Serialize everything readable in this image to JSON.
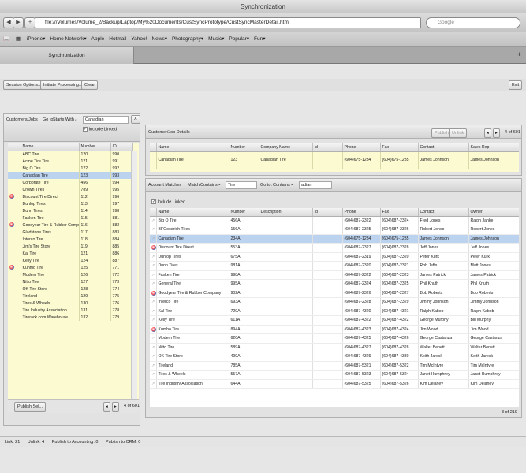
{
  "window": {
    "title": "Synchronization"
  },
  "browser": {
    "url": "file:///Volumes/Volume_2/Backup/Laptop/My%20Documents/CustSyncPrototype/CustSyncMasterDetail.htm",
    "search_placeholder": "Google",
    "bookmarks": [
      "iPhone▾",
      "Home Network▾",
      "Apple",
      "Hotmail",
      "Yahoo!",
      "News▾",
      "Photography▾",
      "Music▾",
      "Popular▾",
      "Fun▾"
    ],
    "tab_label": "Synchronization"
  },
  "toolbar": {
    "session_options": "Session Options...",
    "initiate_processing": "Initiate Processing...",
    "clear": "Clear",
    "exit": "Exit"
  },
  "left_panel": {
    "title": "Customers/Jobs",
    "goto_label": "Go to:",
    "goto_mode": "Starts With",
    "goto_value": "Canadian",
    "clear_x": "X",
    "include_linked": "Include Linked",
    "columns": [
      "Name",
      "Number",
      "ID"
    ],
    "rows": [
      {
        "name": "ABC Tire",
        "number": "120",
        "id": "990",
        "icon": false
      },
      {
        "name": "Acme Tire Tire",
        "number": "121",
        "id": "991",
        "icon": false
      },
      {
        "name": "Big O Tire",
        "number": "122",
        "id": "992",
        "icon": false
      },
      {
        "name": "Canadian Tire",
        "number": "123",
        "id": "993",
        "icon": false
      },
      {
        "name": "Corporate Tire",
        "number": "456",
        "id": "994",
        "icon": false
      },
      {
        "name": "Crown Tires",
        "number": "789",
        "id": "995",
        "icon": false
      },
      {
        "name": "Discount Tire Direct",
        "number": "112",
        "id": "996",
        "icon": true
      },
      {
        "name": "Dunlop Tires",
        "number": "113",
        "id": "997",
        "icon": false
      },
      {
        "name": "Dunn Tires",
        "number": "114",
        "id": "998",
        "icon": false
      },
      {
        "name": "Fasken Tire",
        "number": "115",
        "id": "881",
        "icon": false
      },
      {
        "name": "Goodyear Tire & Rubber Company",
        "number": "116",
        "id": "882",
        "icon": true
      },
      {
        "name": "Gladstone Tires",
        "number": "117",
        "id": "883",
        "icon": false
      },
      {
        "name": "Interco Tire",
        "number": "118",
        "id": "884",
        "icon": false
      },
      {
        "name": "Jim's Tire Store",
        "number": "119",
        "id": "885",
        "icon": false
      },
      {
        "name": "Kal Tire",
        "number": "121",
        "id": "886",
        "icon": false
      },
      {
        "name": "Kelly Tire",
        "number": "124",
        "id": "887",
        "icon": false
      },
      {
        "name": "Kuhmo Tire",
        "number": "125",
        "id": "771",
        "icon": true
      },
      {
        "name": "Modern Tire",
        "number": "126",
        "id": "772",
        "icon": false
      },
      {
        "name": "Nitto Tire",
        "number": "127",
        "id": "773",
        "icon": false
      },
      {
        "name": "OK Tire Store",
        "number": "128",
        "id": "774",
        "icon": false
      },
      {
        "name": "Tireland",
        "number": "129",
        "id": "775",
        "icon": false
      },
      {
        "name": "Tires & Wheels",
        "number": "130",
        "id": "776",
        "icon": false
      },
      {
        "name": "Tire Industry Association",
        "number": "131",
        "id": "778",
        "icon": false
      },
      {
        "name": "Tirerack.com Warehouse",
        "number": "132",
        "id": "779",
        "icon": false
      }
    ],
    "selected_index": 3,
    "publish_button": "Publish Sel...",
    "pager_text": "4 of 601"
  },
  "detail_panel": {
    "title": "Customer/Job Details",
    "publish_button": "Publish",
    "unlink_button": "Unlink",
    "pager_text": "4 of 601",
    "columns": [
      "Name",
      "Number",
      "Company Name",
      "Id",
      "Phone",
      "Fax",
      "Contact",
      "Sales Rep"
    ],
    "row": {
      "name": "Canadian Tire",
      "number": "123",
      "company": "Canadian Tire",
      "id": "",
      "phone": "(604)675-1234",
      "fax": "(604)675-1235",
      "contact": "James Johnson",
      "rep": "James Johnson"
    }
  },
  "matches_panel": {
    "title": "Account Matches",
    "match_label": "Match:",
    "match_mode": "Contains",
    "match_value": "Tire",
    "goto_label": "Go to:",
    "goto_mode": "Contains",
    "goto_value": "adian",
    "include_linked": "Include Linked",
    "columns": [
      "Name",
      "Number",
      "Description",
      "Id",
      "Phone",
      "Fax",
      "Contact",
      "Owner"
    ],
    "rows": [
      {
        "name": "Big O Tire",
        "number": "456A",
        "phone": "(604)687-2322",
        "fax": "(604)687-2324",
        "contact": "Fred Jones",
        "owner": "Ralph Janke",
        "icon": false
      },
      {
        "name": "BFGoodrich Tires",
        "number": "156A",
        "phone": "(604)687-2325",
        "fax": "(604)687-2326",
        "contact": "Robert Jones",
        "owner": "Robert Jones",
        "icon": false
      },
      {
        "name": "Canadian Tire",
        "number": "234A",
        "phone": "(604)675-1234",
        "fax": "(604)675-1235",
        "contact": "James Johnson",
        "owner": "James Johnson",
        "icon": false
      },
      {
        "name": "Discount Tire Direct",
        "number": "553A",
        "phone": "(604)687-2327",
        "fax": "(604)687-2328",
        "contact": "Jeff Jones",
        "owner": "Jeff Jones",
        "icon": true
      },
      {
        "name": "Dunlop Tires",
        "number": "675A",
        "phone": "(604)687-2319",
        "fax": "(604)687-2320",
        "contact": "Peter Kurk",
        "owner": "Peter Kurk",
        "icon": false
      },
      {
        "name": "Dunn Tires",
        "number": "981A",
        "phone": "(604)687-2320",
        "fax": "(604)687-2321",
        "contact": "Rob Jeffs",
        "owner": "Matt Jones",
        "icon": false
      },
      {
        "name": "Fasken Tire",
        "number": "998A",
        "phone": "(604)687-2322",
        "fax": "(604)687-2323",
        "contact": "James Patrick",
        "owner": "James Patrick",
        "icon": false
      },
      {
        "name": "General Tire",
        "number": "995A",
        "phone": "(604)687-2324",
        "fax": "(604)687-2325",
        "contact": "Phil Knuth",
        "owner": "Phil Knuth",
        "icon": false
      },
      {
        "name": "Goodyear Tire & Rubber Company",
        "number": "902A",
        "phone": "(604)687-2326",
        "fax": "(604)687-2327",
        "contact": "Bob Roberts",
        "owner": "Bob Roberts",
        "icon": true
      },
      {
        "name": "Interco Tire",
        "number": "693A",
        "phone": "(604)687-2328",
        "fax": "(604)687-2329",
        "contact": "Jimmy Johnson",
        "owner": "Jimmy Johnson",
        "icon": false
      },
      {
        "name": "Kal Tire",
        "number": "729A",
        "phone": "(604)687-4320",
        "fax": "(604)687-4321",
        "contact": "Ralph Kabob",
        "owner": "Ralph Kabob",
        "icon": false
      },
      {
        "name": "Kelly Tire",
        "number": "611A",
        "phone": "(604)687-4322",
        "fax": "(604)687-4322",
        "contact": "George Murphy",
        "owner": "Bill Murphy",
        "icon": false
      },
      {
        "name": "Kumho Tire",
        "number": "894A",
        "phone": "(604)687-4323",
        "fax": "(604)687-4324",
        "contact": "Jim Wood",
        "owner": "Jim Wood",
        "icon": true
      },
      {
        "name": "Modern Tire",
        "number": "620A",
        "phone": "(604)687-4325",
        "fax": "(604)687-4326",
        "contact": "George Castanza",
        "owner": "George Castanza",
        "icon": false
      },
      {
        "name": "Nitto Tire",
        "number": "589A",
        "phone": "(604)687-4327",
        "fax": "(604)687-4328",
        "contact": "Walter Benett",
        "owner": "Walter Benett",
        "icon": false
      },
      {
        "name": "OK Tire Store",
        "number": "499A",
        "phone": "(604)687-4329",
        "fax": "(604)687-4330",
        "contact": "Keith Jareck",
        "owner": "Keith Jareck",
        "icon": false
      },
      {
        "name": "Tireland",
        "number": "785A",
        "phone": "(604)687-5321",
        "fax": "(604)687-5322",
        "contact": "Tim McIntyre",
        "owner": "Tim McIntyre",
        "icon": false
      },
      {
        "name": "Tires & Wheels",
        "number": "557A",
        "phone": "(604)687-5323",
        "fax": "(604)687-5324",
        "contact": "Janet Humphrey",
        "owner": "Janet Humphrey",
        "icon": false
      },
      {
        "name": "Tire Industry Association",
        "number": "644A",
        "phone": "(604)687-5325",
        "fax": "(604)687-5326",
        "contact": "Kim Delaney",
        "owner": "Kim Delaney",
        "icon": false
      }
    ],
    "selected_index": 2,
    "pager_text": "3 of 219"
  },
  "status": {
    "links": "Link: 21",
    "unlinks": "Unlink: 4",
    "accounting": "Publish to Accounting: 0",
    "crm": "Publish to CRM: 0"
  }
}
